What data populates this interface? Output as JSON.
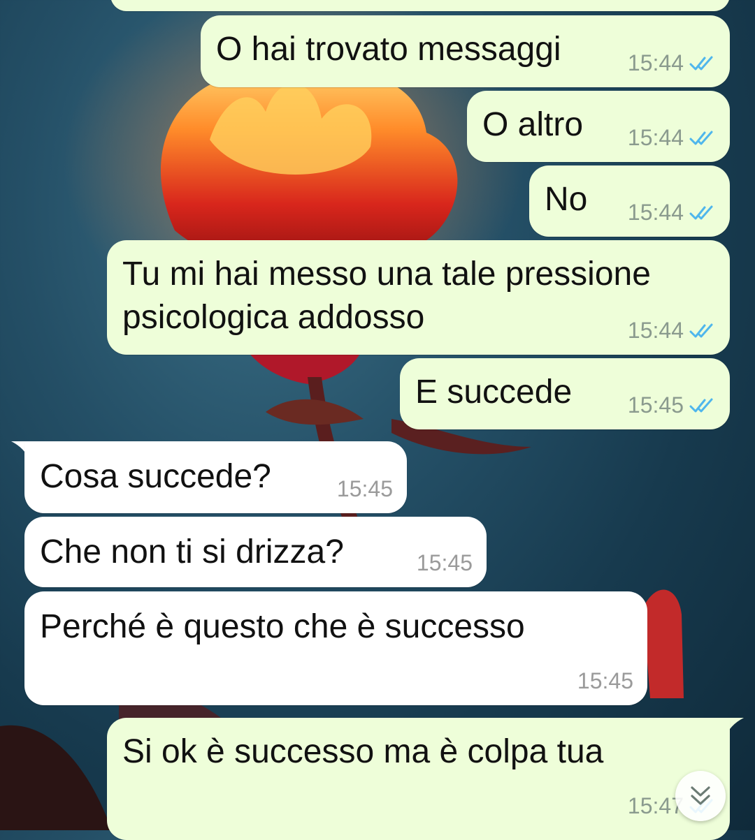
{
  "chat": {
    "messages": [
      {
        "direction": "out",
        "text": "O hai trovato messaggi",
        "time": "15:44",
        "status": "read"
      },
      {
        "direction": "out",
        "text": "O altro",
        "time": "15:44",
        "status": "read"
      },
      {
        "direction": "out",
        "text": "No",
        "time": "15:44",
        "status": "read"
      },
      {
        "direction": "out",
        "text": "Tu mi hai messo una tale pressione\npsicologica addosso",
        "time": "15:44",
        "status": "read"
      },
      {
        "direction": "out",
        "text": "E succede",
        "time": "15:45",
        "status": "read"
      },
      {
        "direction": "in",
        "text": "Cosa succede?",
        "time": "15:45"
      },
      {
        "direction": "in",
        "text": "Che non ti si drizza?",
        "time": "15:45"
      },
      {
        "direction": "in",
        "text": "Perché è questo che è successo",
        "time": "15:45"
      },
      {
        "direction": "out",
        "text": "Si ok è successo ma è colpa tua",
        "time": "15:47",
        "status": "read"
      }
    ]
  },
  "icons": {
    "read_receipt": "double-check-icon",
    "scroll_button": "chevron-double-down-icon"
  },
  "colors": {
    "outgoing_bubble": "#eefed9",
    "incoming_bubble": "#ffffff",
    "read_ticks": "#4fb6ec"
  }
}
